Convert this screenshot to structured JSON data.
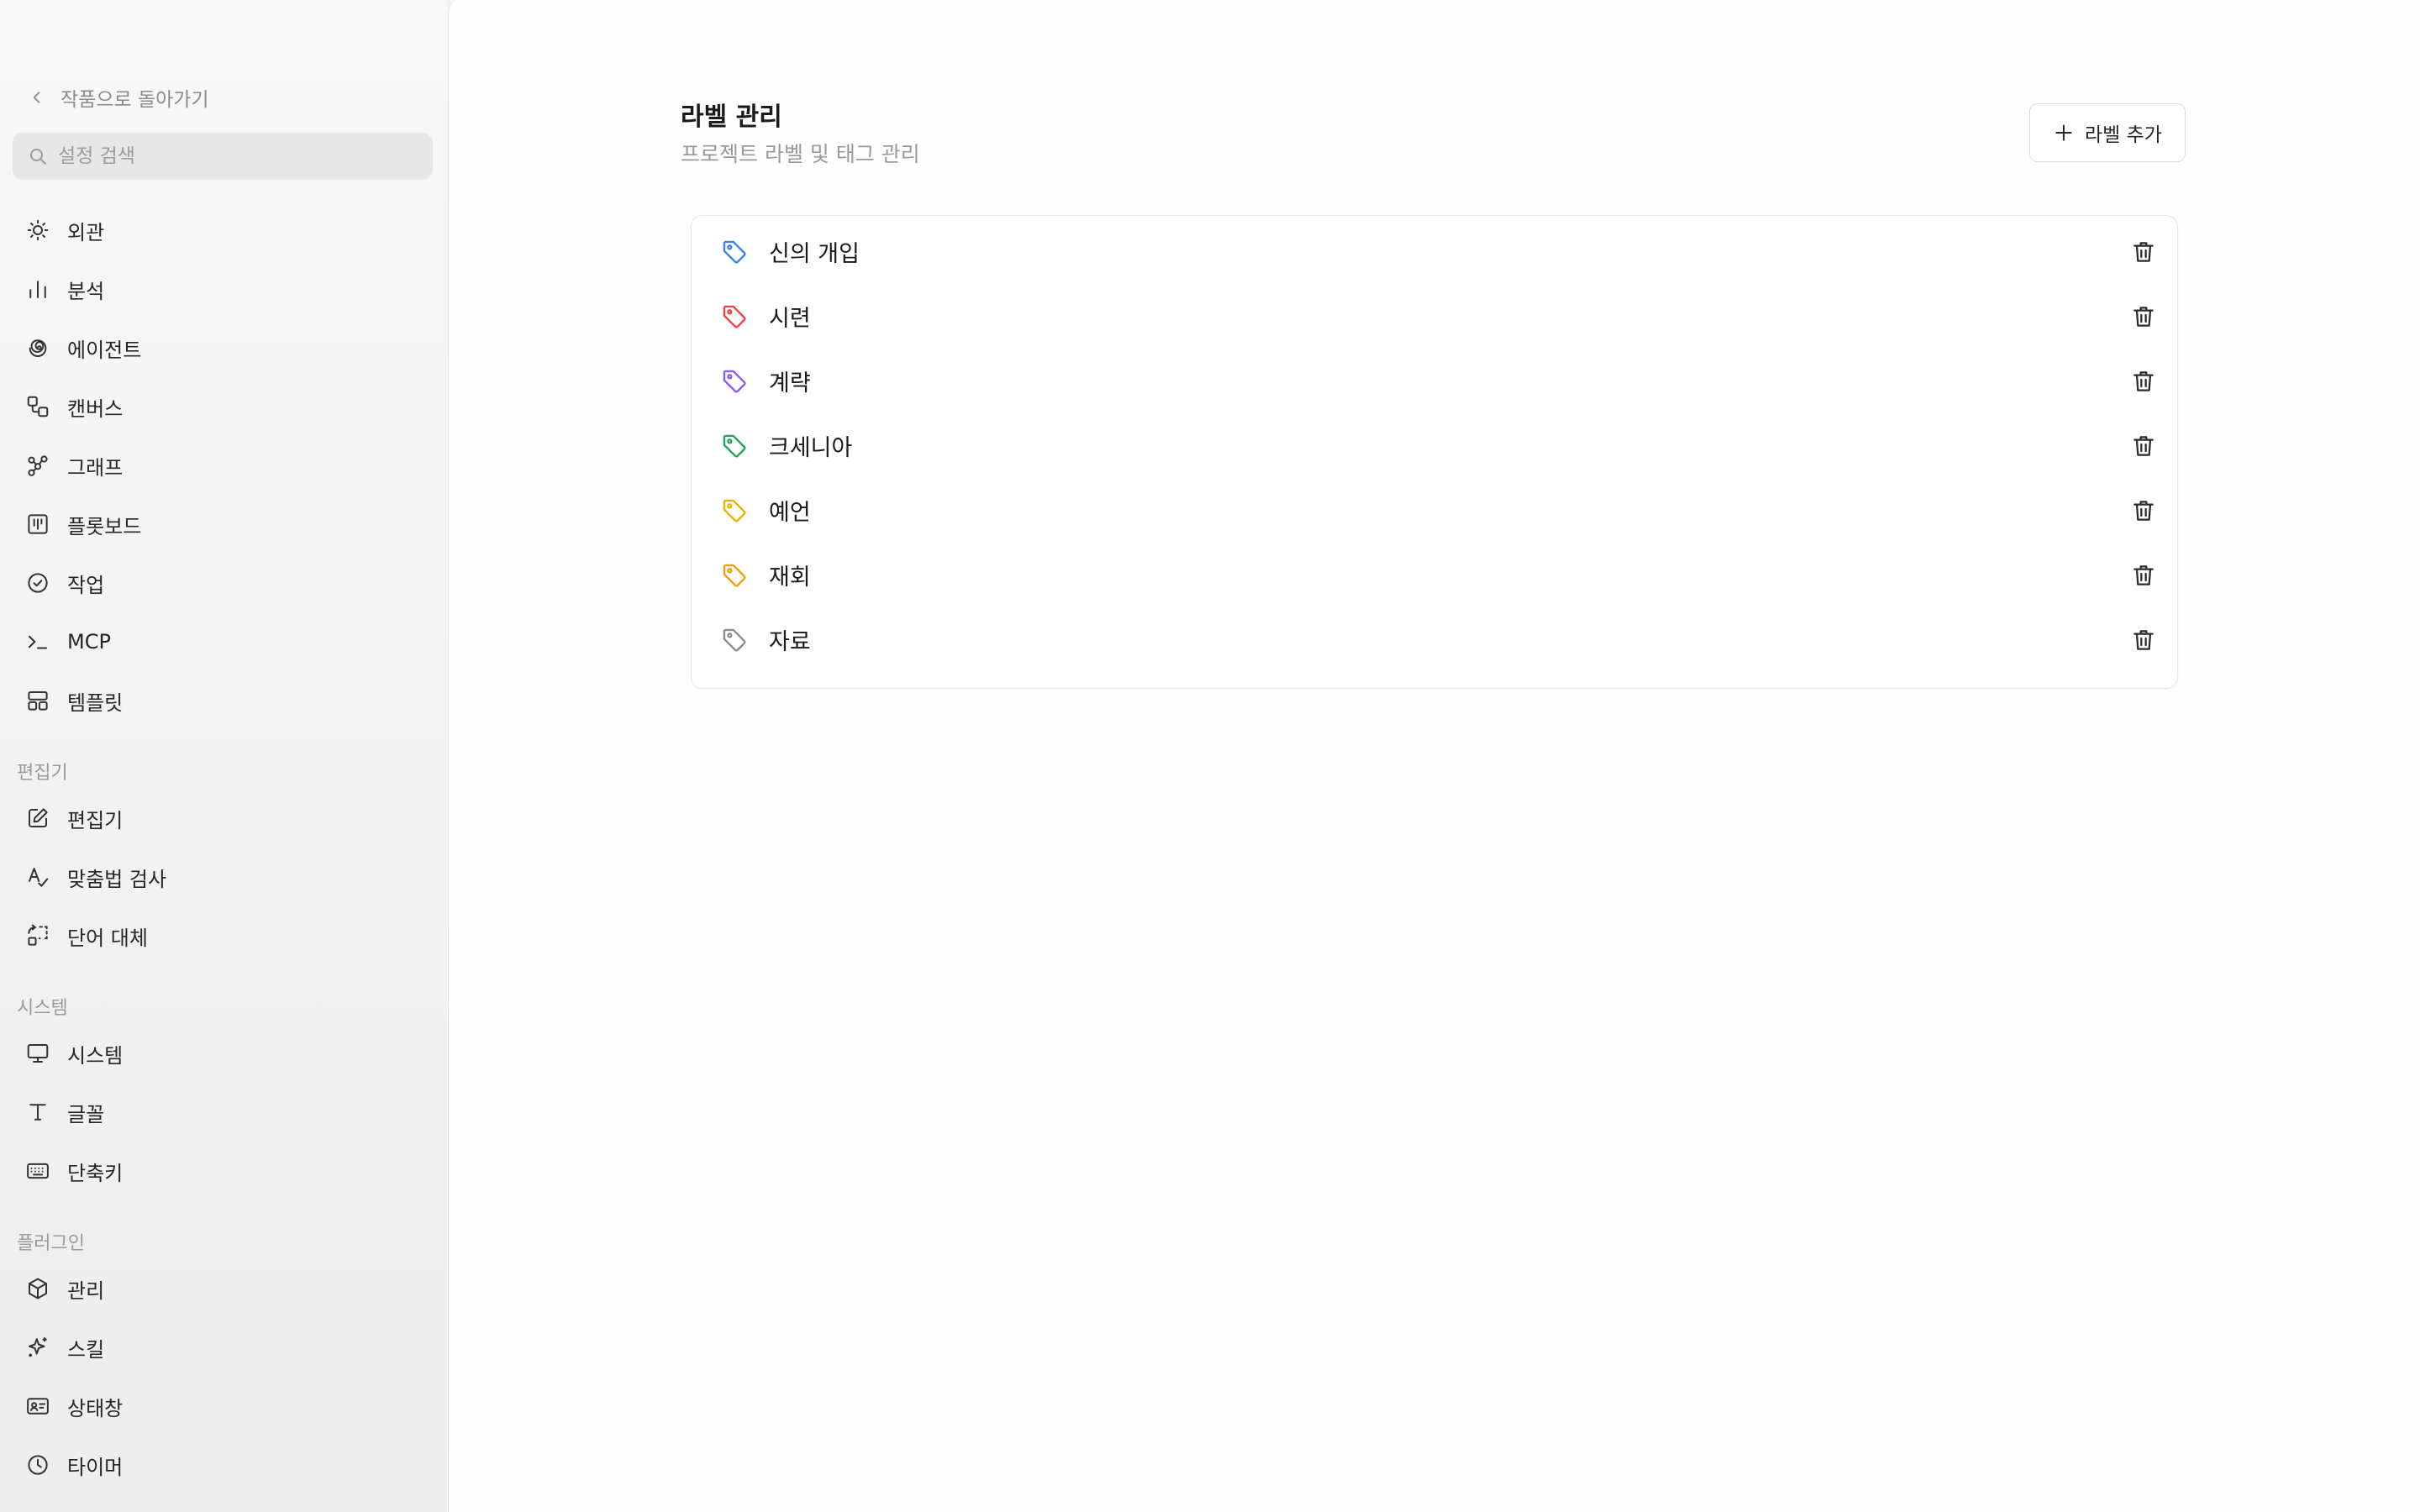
{
  "sidebar": {
    "back_label": "작품으로 돌아가기",
    "search_placeholder": "설정 검색",
    "items_top": [
      {
        "label": "외관",
        "icon": "sun-icon"
      },
      {
        "label": "분석",
        "icon": "bar-chart-icon"
      },
      {
        "label": "에이전트",
        "icon": "spiral-icon"
      },
      {
        "label": "캔버스",
        "icon": "shapes-icon"
      },
      {
        "label": "그래프",
        "icon": "network-icon"
      },
      {
        "label": "플롯보드",
        "icon": "kanban-icon"
      },
      {
        "label": "작업",
        "icon": "check-circle-icon"
      },
      {
        "label": "MCP",
        "icon": "terminal-icon"
      },
      {
        "label": "템플릿",
        "icon": "layout-icon"
      }
    ],
    "section_editor": "편집기",
    "items_editor": [
      {
        "label": "편집기",
        "icon": "edit-icon"
      },
      {
        "label": "맞춤법 검사",
        "icon": "spell-check-icon"
      },
      {
        "label": "단어 대체",
        "icon": "replace-icon"
      }
    ],
    "section_system": "시스템",
    "items_system": [
      {
        "label": "시스템",
        "icon": "monitor-icon"
      },
      {
        "label": "글꼴",
        "icon": "type-icon"
      },
      {
        "label": "단축키",
        "icon": "keyboard-icon"
      }
    ],
    "section_plugins": "플러그인",
    "items_plugins": [
      {
        "label": "관리",
        "icon": "package-icon"
      },
      {
        "label": "스킬",
        "icon": "sparkles-icon"
      },
      {
        "label": "상태창",
        "icon": "id-card-icon"
      },
      {
        "label": "타이머",
        "icon": "clock-icon"
      }
    ]
  },
  "main": {
    "title": "라벨 관리",
    "subtitle": "프로젝트 라벨 및 태그 관리",
    "add_button_label": "라벨 추가",
    "labels": [
      {
        "name": "신의 개입",
        "color": "#3b82f6"
      },
      {
        "name": "시련",
        "color": "#ef4444"
      },
      {
        "name": "계략",
        "color": "#8b5cf6"
      },
      {
        "name": "크세니아",
        "color": "#22a55a"
      },
      {
        "name": "예언",
        "color": "#eab308"
      },
      {
        "name": "재회",
        "color": "#f59e0b"
      },
      {
        "name": "자료",
        "color": "#8e8e8e"
      }
    ]
  }
}
